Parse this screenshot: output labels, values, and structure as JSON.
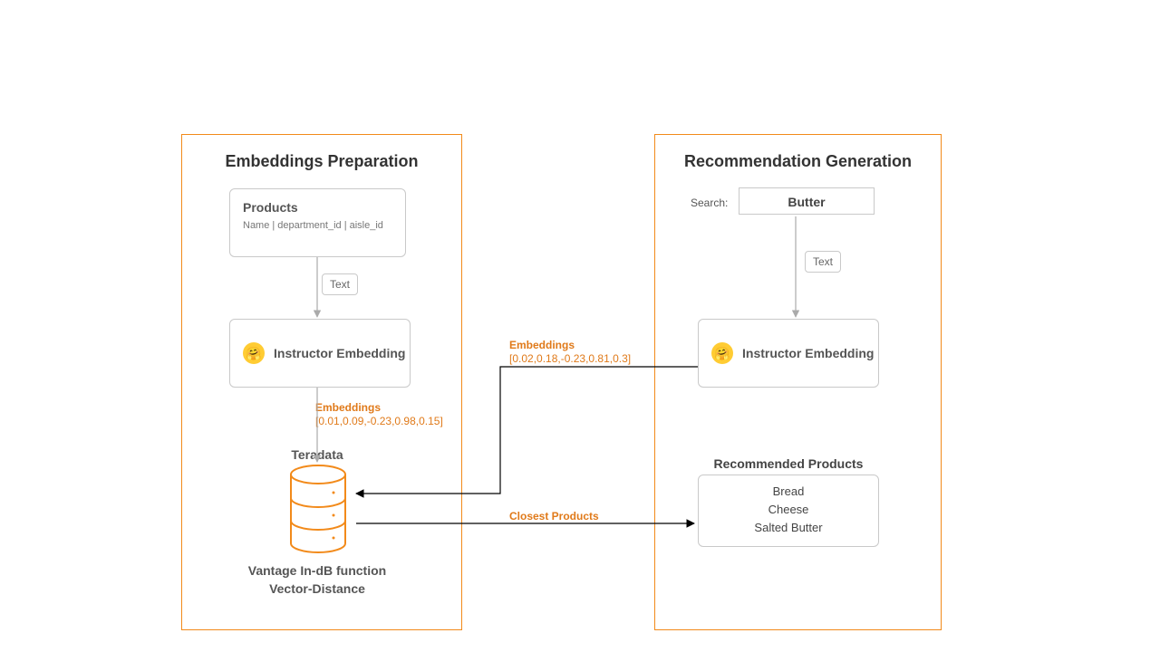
{
  "left": {
    "title": "Embeddings Preparation",
    "products": {
      "title": "Products",
      "schema": "Name | department_id | aisle_id"
    },
    "text_chip": "Text",
    "embed_label": "Instructor Embedding",
    "embeddings_label": "Embeddings",
    "embeddings_vector": "[0.01,0.09,-0.23,0.98,0.15]",
    "db_title": "Teradata",
    "db_caption_1": "Vantage In-dB function",
    "db_caption_2": "Vector-Distance"
  },
  "right": {
    "title": "Recommendation Generation",
    "search_label": "Search:",
    "search_value": "Butter",
    "text_chip": "Text",
    "embed_label": "Instructor Embedding",
    "rec_title": "Recommended Products",
    "rec_items": [
      "Bread",
      "Cheese",
      "Salted Butter"
    ]
  },
  "center": {
    "embeddings_label": "Embeddings",
    "embeddings_vector": "[0.02,0.18,-0.23,0.81,0.3]",
    "closest_label": "Closest Products"
  }
}
